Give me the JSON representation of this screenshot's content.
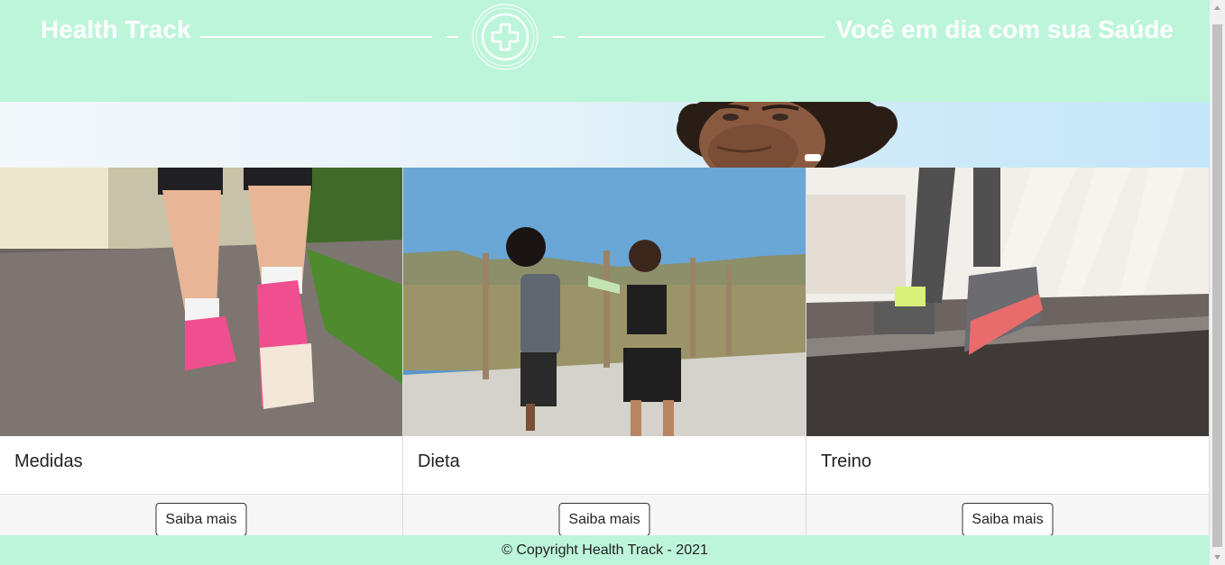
{
  "header": {
    "brand": "Health Track",
    "tagline": "Você em dia com sua Saúde",
    "logo_icon": "medical-cross-icon",
    "background": "#bdf5da"
  },
  "hero": {
    "image_icon": "smiling-man-photo"
  },
  "cards": [
    {
      "title": "Medidas",
      "button": "Saiba mais",
      "image": "walking-feet-pink-sneakers-photo"
    },
    {
      "title": "Dieta",
      "button": "Saiba mais",
      "image": "couple-walking-outdoors-photo"
    },
    {
      "title": "Treino",
      "button": "Saiba mais",
      "image": "treadmill-running-photo"
    }
  ],
  "footer": {
    "text": "© Copyright Health Track - 2021",
    "background": "#bdf5da"
  }
}
